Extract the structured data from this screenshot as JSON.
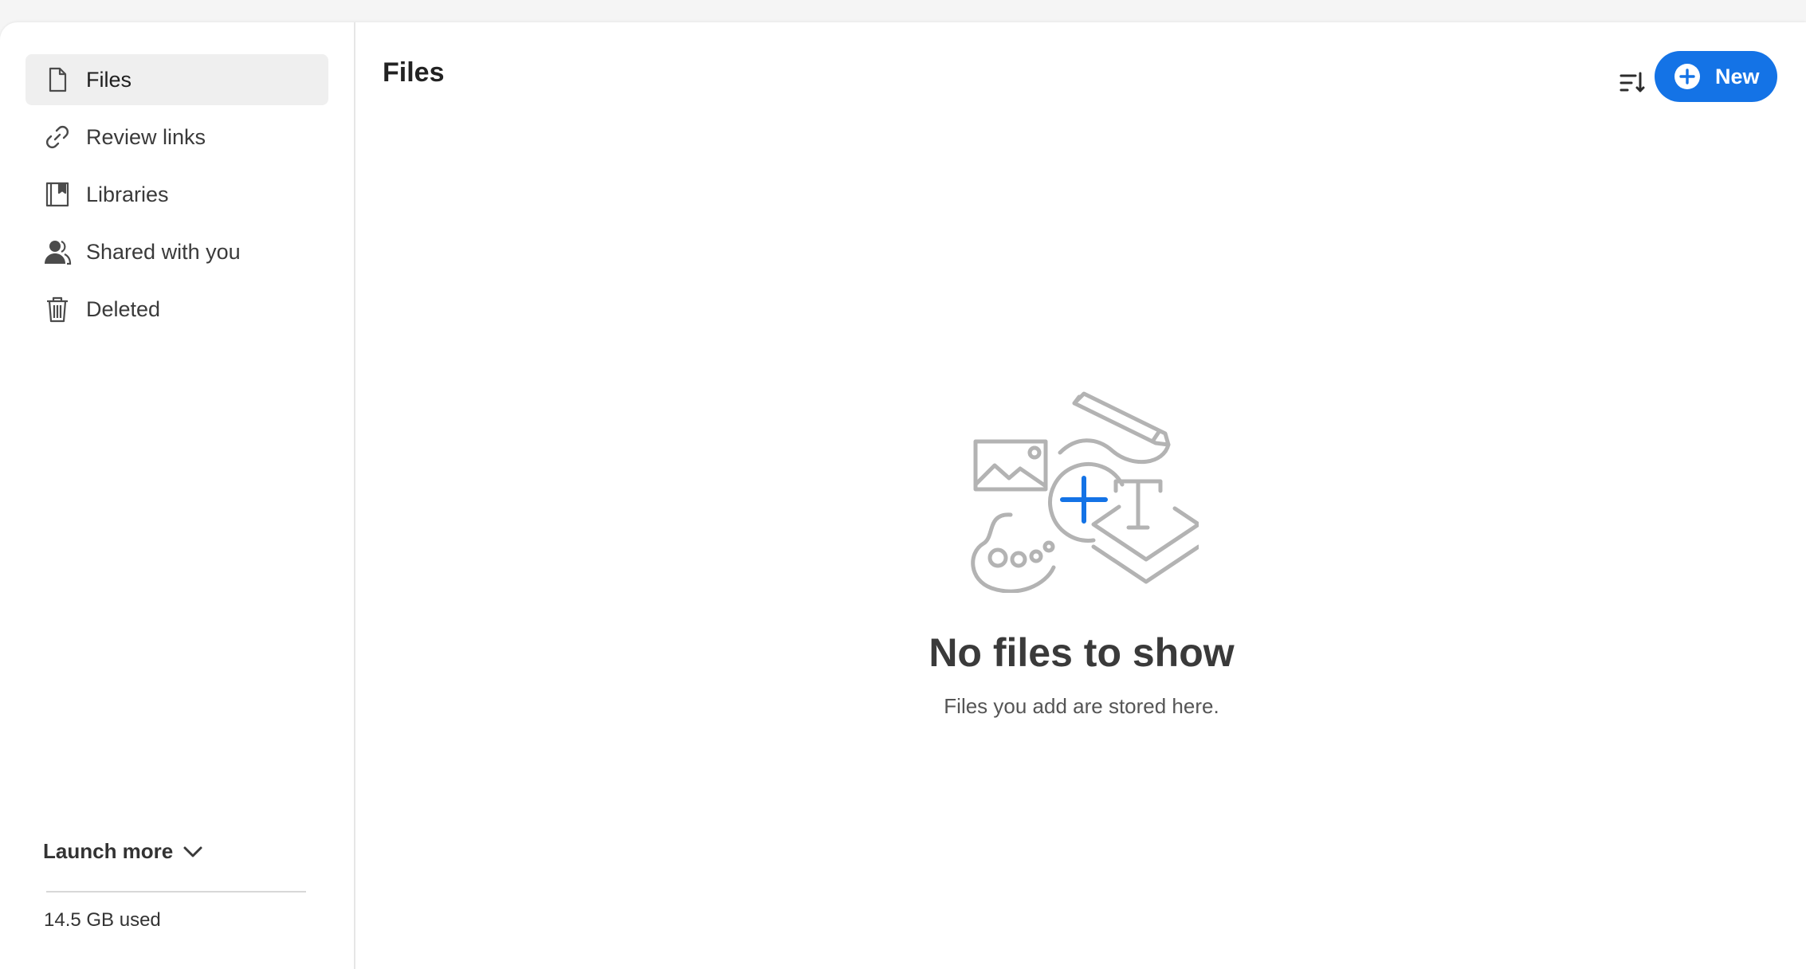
{
  "sidebar": {
    "items": [
      {
        "label": "Files",
        "icon": "file-icon"
      },
      {
        "label": "Review links",
        "icon": "link-icon"
      },
      {
        "label": "Libraries",
        "icon": "library-icon"
      },
      {
        "label": "Shared with you",
        "icon": "user-icon"
      },
      {
        "label": "Deleted",
        "icon": "trash-icon"
      }
    ],
    "launch_more": "Launch more",
    "storage_used": "14.5 GB used"
  },
  "main": {
    "title": "Files",
    "new_button": "New",
    "empty_state": {
      "title": "No files to show",
      "subtitle": "Files you add are stored here."
    }
  },
  "colors": {
    "accent": "#1473e6",
    "active_bg": "#efefef",
    "illustration_gray": "#b3b3b3"
  }
}
